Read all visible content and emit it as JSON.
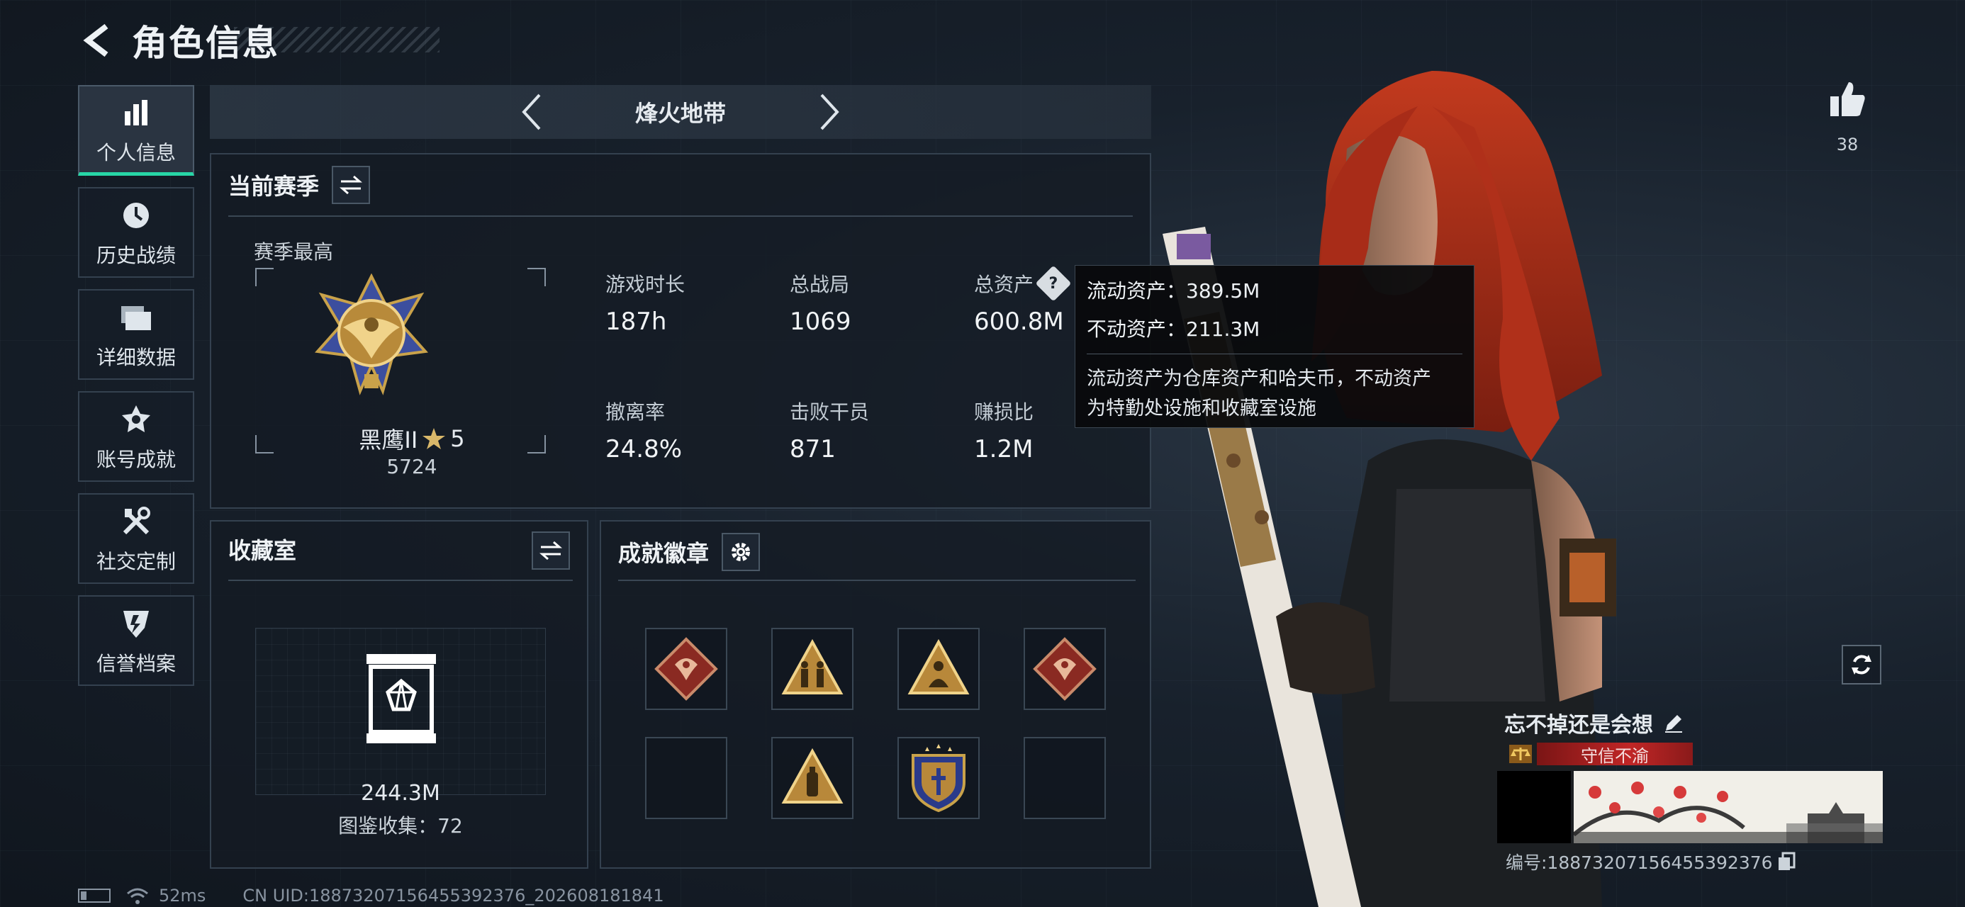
{
  "header": {
    "title": "角色信息"
  },
  "sidebar": {
    "items": [
      {
        "label": "个人信息",
        "icon": "bar-chart-icon",
        "active": true
      },
      {
        "label": "历史战绩",
        "icon": "clock-icon",
        "active": false
      },
      {
        "label": "详细数据",
        "icon": "folder-icon",
        "active": false
      },
      {
        "label": "账号成就",
        "icon": "medal-icon",
        "active": false
      },
      {
        "label": "社交定制",
        "icon": "tools-icon",
        "active": false
      },
      {
        "label": "信誉档案",
        "icon": "shield-icon",
        "active": false
      }
    ]
  },
  "mode": {
    "title": "烽火地带"
  },
  "season": {
    "title": "当前赛季",
    "subtitle": "赛季最高",
    "rank_name": "黑鹰II",
    "rank_stars": "5",
    "rank_score": "5724",
    "stats": [
      {
        "label": "游戏时长",
        "value": "187h"
      },
      {
        "label": "总战局",
        "value": "1069"
      },
      {
        "label": "总资产",
        "value": "600.8M"
      },
      {
        "label": "撤离率",
        "value": "24.8%"
      },
      {
        "label": "击败干员",
        "value": "871"
      },
      {
        "label": "赚损比",
        "value": "1.2M"
      }
    ]
  },
  "tooltip": {
    "liquid": "流动资产：389.5M",
    "fixed": "不动资产：211.3M",
    "desc_line1": "流动资产为仓库资产和哈夫币，不动资产",
    "desc_line2": "为特勤处设施和收藏室设施"
  },
  "collection": {
    "title": "收藏室",
    "value": "244.3M",
    "count": "图鉴收集：72"
  },
  "achievements": {
    "title": "成就徽章",
    "slots": [
      {
        "icon": "dragon-badge-icon",
        "filled": true
      },
      {
        "icon": "triangle-figures-badge-icon",
        "filled": true
      },
      {
        "icon": "triangle-soldier-badge-icon",
        "filled": true
      },
      {
        "icon": "dragon-badge-icon",
        "filled": true
      },
      {
        "icon": "empty-slot",
        "filled": false
      },
      {
        "icon": "triangle-extinguisher-badge-icon",
        "filled": true
      },
      {
        "icon": "shield-emblem-badge-icon",
        "filled": true
      },
      {
        "icon": "empty-slot",
        "filled": false
      }
    ]
  },
  "profile": {
    "likes": "38",
    "name": "忘不掉还是会想",
    "honor": "守信不渝",
    "id_text": "编号:18873207156455392376"
  },
  "statusbar": {
    "ping": "52ms",
    "uid": "CN UID:18873207156455392376_202608181841"
  },
  "colors": {
    "accent": "#27d6a6",
    "honor_red": "#c02626",
    "hair": "#b8331c"
  }
}
